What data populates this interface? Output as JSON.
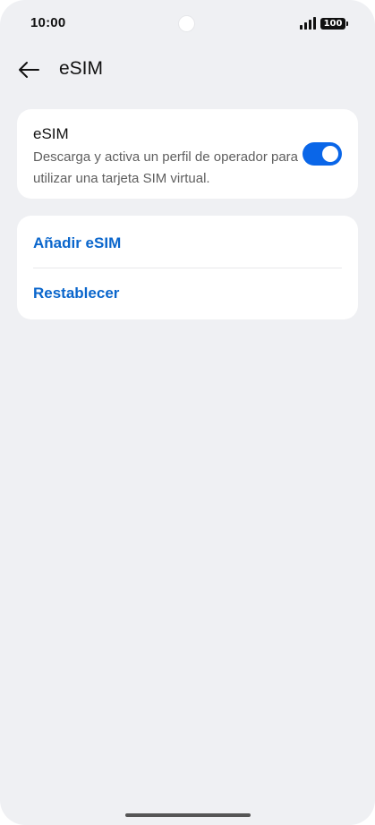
{
  "status_bar": {
    "time": "10:00",
    "battery_level": "100",
    "icons": [
      "signal-icon",
      "battery-icon",
      "camera-cutout"
    ]
  },
  "header": {
    "back_icon": "arrow-left-icon",
    "title": "eSIM"
  },
  "esim_card": {
    "title": "eSIM",
    "description": "Descarga y activa un perfil de operador para utilizar una tarjeta SIM virtual.",
    "toggle_on": true
  },
  "actions": {
    "add_esim": "Añadir eSIM",
    "reset": "Restablecer"
  },
  "colors": {
    "accent": "#0a66e8",
    "link": "#0a66cc",
    "background": "#eff0f3",
    "card": "#ffffff"
  }
}
